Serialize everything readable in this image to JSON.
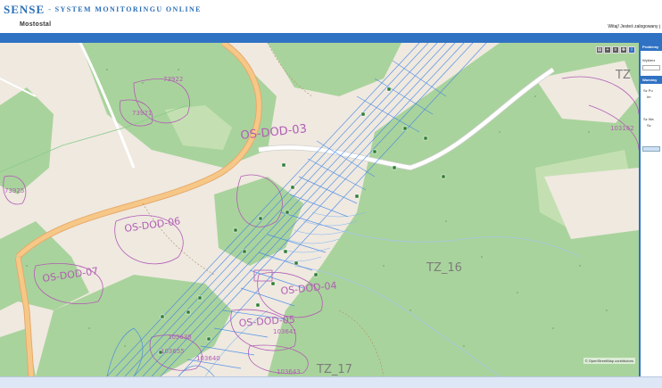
{
  "header": {
    "brand": "Sense",
    "brand_sub": "- system monitoringu online",
    "company": "Mostostal",
    "welcome": "Witaj! Jesteś zalogowany j"
  },
  "map": {
    "zone_labels": [
      "OS-DOD-03",
      "OS-DOD-06",
      "OS-DOD-07",
      "OS-DOD-04",
      "OS-DOD-05",
      "TZ_16",
      "TZ_17",
      "TZ"
    ],
    "parcel_labels": [
      "73922",
      "73921",
      "73925",
      "103640",
      "103641",
      "103638",
      "103643",
      "103655",
      "103162"
    ],
    "attribution": "© OpenStreetMap contributors",
    "tool_icons": [
      "print-icon",
      "zoom-icon",
      "layers-icon",
      "pan-icon",
      "info-icon"
    ]
  },
  "panel": {
    "title1": "Problemy",
    "select_label": "Wybierz",
    "title2": "Warstwy",
    "tree": [
      "Sz Pu",
      "Im",
      "Sz Wa",
      "Sz"
    ]
  }
}
